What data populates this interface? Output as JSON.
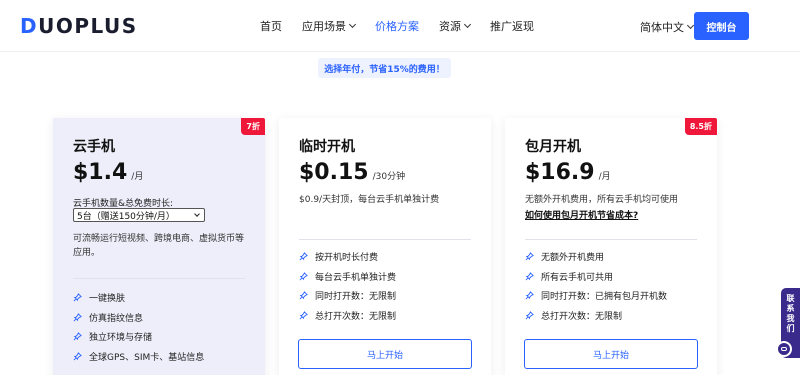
{
  "logo": {
    "text_d": "D",
    "text_rest": "UOPLUS"
  },
  "nav": {
    "items": [
      {
        "label": "首页",
        "has_dropdown": false,
        "active": false
      },
      {
        "label": "应用场景",
        "has_dropdown": true,
        "active": false
      },
      {
        "label": "价格方案",
        "has_dropdown": false,
        "active": true
      },
      {
        "label": "资源",
        "has_dropdown": true,
        "active": false
      },
      {
        "label": "推广返现",
        "has_dropdown": false,
        "active": false
      }
    ],
    "language": "简体中文",
    "console_button": "控制台"
  },
  "promo_text": "选择年付，节省15%的费用！",
  "cards": [
    {
      "title": "云手机",
      "badge": "7折",
      "price": "$1.4",
      "price_unit": "/月",
      "quantity_label": "云手机数量&总免费时长:",
      "quantity_value": "5台（赠送150分钟/月）",
      "description": "可流畅运行短视频、跨境电商、虚拟货币等应用。",
      "features": [
        "一键换肤",
        "仿真指纹信息",
        "独立环境与存储",
        "全球GPS、SIM卡、基站信息"
      ]
    },
    {
      "title": "临时开机",
      "price": "$0.15",
      "price_unit": "/30分钟",
      "description": "$0.9/天封顶，每台云手机单独计费",
      "features": [
        "按开机时长付费",
        "每台云手机单独计费",
        "同时打开数：无限制",
        "总打开次数：无限制"
      ],
      "button": "马上开始"
    },
    {
      "title": "包月开机",
      "badge": "8.5折",
      "price": "$16.9",
      "price_unit": "/月",
      "description": "无额外开机费用，所有云手机均可使用",
      "link": "如何使用包月开机节省成本?",
      "features": [
        "无额外开机费用",
        "所有云手机可共用",
        "同时打开数：已拥有包月开机数",
        "总打开次数：无限制"
      ],
      "button": "马上开始"
    }
  ],
  "contact_tab": [
    "联",
    "系",
    "我",
    "们"
  ],
  "colors": {
    "accent": "#2a62ff",
    "badge": "#f0183a",
    "contact": "#3a2a8c"
  }
}
